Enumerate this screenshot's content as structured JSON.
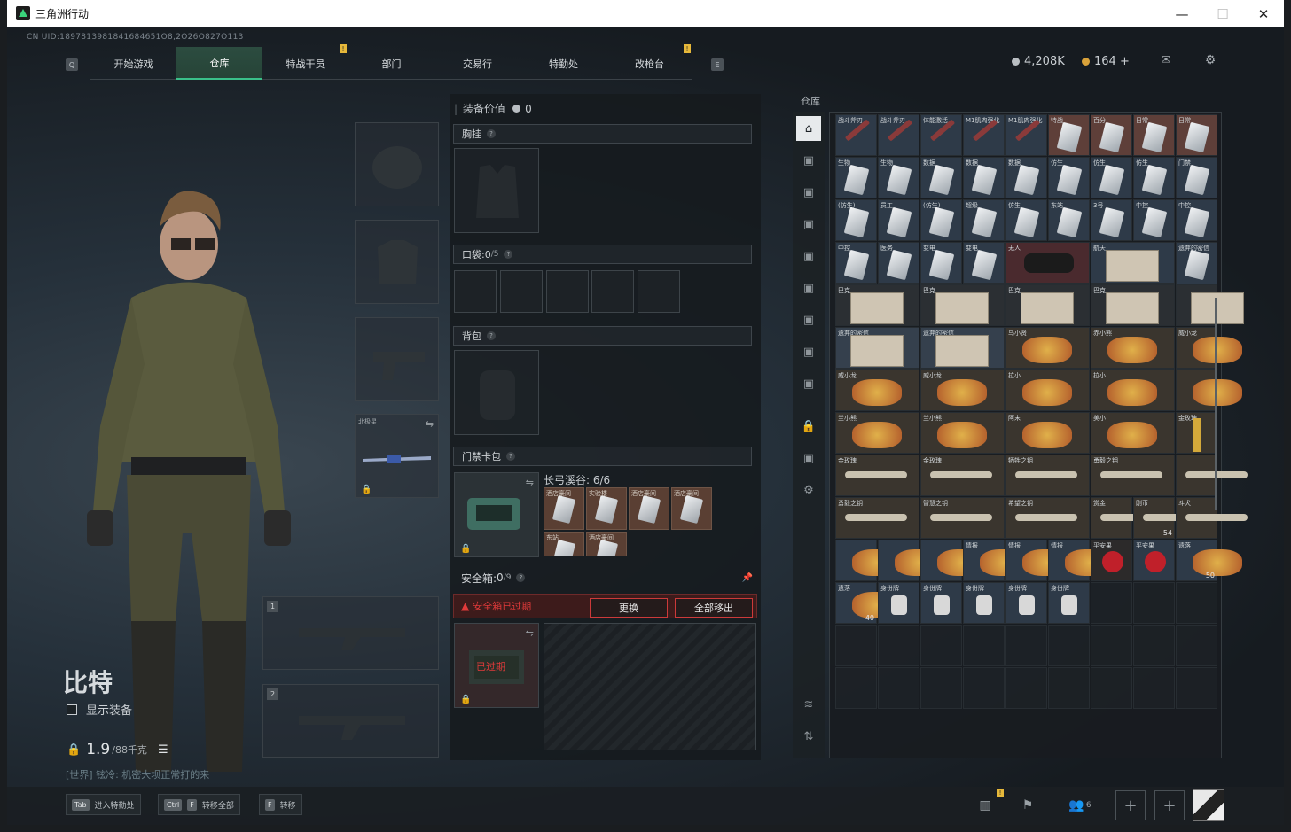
{
  "window": {
    "title": "三角洲行动",
    "min": "—",
    "max": "☐",
    "close": "✕"
  },
  "uid": "CN UID:1897813981841684651O8,2O26O827O113",
  "nav": {
    "key_left": "Q",
    "key_right": "E",
    "items": [
      {
        "label": "开始游戏",
        "active": false,
        "badge": ""
      },
      {
        "label": "仓库",
        "active": true,
        "badge": ""
      },
      {
        "label": "特战干员",
        "active": false,
        "badge": "!"
      },
      {
        "label": "部门",
        "active": false,
        "badge": ""
      },
      {
        "label": "交易行",
        "active": false,
        "badge": ""
      },
      {
        "label": "特勤处",
        "active": false,
        "badge": ""
      },
      {
        "label": "改枪台",
        "active": false,
        "badge": "!"
      }
    ]
  },
  "currency": {
    "coins": "4,208K",
    "points": "164 +"
  },
  "character": {
    "name": "比特",
    "show_gear_label": "显示装备",
    "weight_value": "1.9",
    "weight_cap": "/88千克",
    "chat": "[世界] 铉冷: 机密大坝正常打的来"
  },
  "gear_slots": {
    "melee_label": "北极星"
  },
  "equip": {
    "value_label": "装备价值",
    "value": "0",
    "chest_label": "胸挂",
    "pocket_label": "口袋: ",
    "pocket_count": "0",
    "pocket_cap": "/5",
    "backpack_label": "背包",
    "keycard_label": "门禁卡包",
    "keycard_title": "长弓溪谷: 6/6",
    "cards": [
      "酒店豪间",
      "实验楼",
      "酒店豪间",
      "酒店豪间",
      "东站",
      "酒店豪间"
    ],
    "safe_label": "安全箱: ",
    "safe_count": "0",
    "safe_cap": "/9",
    "expired_warning": "安全箱已过期",
    "replace_btn": "更换",
    "remove_all_btn": "全部移出",
    "expired_stamp": "已过期"
  },
  "warehouse": {
    "title": "仓库",
    "items": [
      [
        "战斗斧刃",
        "战斗斧刃",
        "体能激活",
        "M1肌肉强化",
        "M1肌肉强化",
        "特战",
        "百分",
        "日常",
        "日常"
      ],
      [
        "生物",
        "生物",
        "数据",
        "数据",
        "数据",
        "仿生",
        "仿生",
        "仿生",
        "门禁"
      ],
      [
        "(仿生)",
        "员工",
        "(仿生)",
        "超级",
        "仿生",
        "东站",
        "3号",
        "中控",
        "中控"
      ],
      [
        "中控",
        "医务",
        "变电",
        "变电",
        "无人",
        "",
        "航天",
        "",
        "遗弃的密信"
      ],
      [
        "巴克",
        "",
        "巴克",
        "",
        "巴克",
        "",
        "巴克",
        "",
        ""
      ],
      [
        "遗弃的密信",
        "",
        "遗弃的密信",
        "",
        "乌小贤",
        "",
        "赤小熊",
        "",
        "威小龙"
      ],
      [
        "威小龙",
        "",
        "威小龙",
        "",
        "拉小",
        "",
        "拉小",
        "",
        ""
      ],
      [
        "兰小熊",
        "",
        "兰小熊",
        "",
        "阿末",
        "",
        "美小",
        "",
        "金玫瑰"
      ],
      [
        "金玫瑰",
        "",
        "金玫瑰",
        "",
        "牺牲之钥",
        "",
        "勇毅之钥",
        "",
        ""
      ],
      [
        "勇毅之钥",
        "",
        "智慧之钥",
        "",
        "希望之钥",
        "",
        "赏金",
        "刚币",
        "斗犬"
      ],
      [
        "",
        "",
        "",
        "情报",
        "情报",
        "情报",
        "平安果",
        "平安果",
        "遗落"
      ],
      [
        "遗落",
        "身份牌",
        "身份牌",
        "身份牌",
        "身份牌",
        "身份牌",
        "",
        "",
        ""
      ]
    ],
    "counts": {
      "gold": "54",
      "shard1": "50",
      "shard2": "40"
    }
  },
  "bottom": {
    "hint1_key": "Tab",
    "hint1": "进入特勤处",
    "hint2_key": "Ctrl",
    "hint2_key2": "F",
    "hint2": "转移全部",
    "hint3_key": "F",
    "hint3": "转移",
    "friends": "6"
  }
}
